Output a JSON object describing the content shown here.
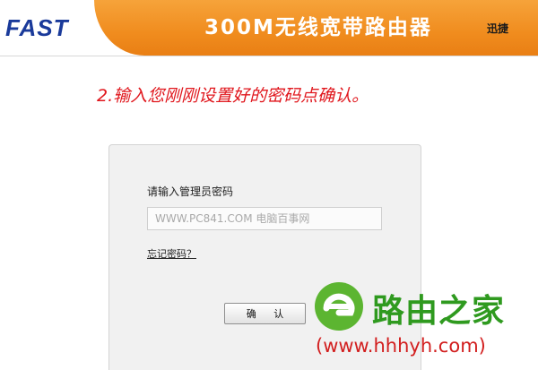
{
  "header": {
    "logo": "FAST",
    "product_title": "300M无线宽带路由器",
    "product_sub": "迅捷"
  },
  "instruction": "2.输入您刚刚设置好的密码点确认。",
  "login": {
    "prompt_label": "请输入管理员密码",
    "password_placeholder": "WWW.PC841.COM 电脑百事网",
    "forgot_link": "忘记密码？",
    "confirm_button": "确 认"
  },
  "watermark": {
    "site_name": "路由之家",
    "url": "(www.hhhyh.com)"
  },
  "colors": {
    "header_orange": "#f08c1e",
    "instruction_red": "#e0161c",
    "watermark_green": "#2f9a1f",
    "watermark_red": "#d21e1e",
    "logo_blue": "#1a3a9a"
  }
}
